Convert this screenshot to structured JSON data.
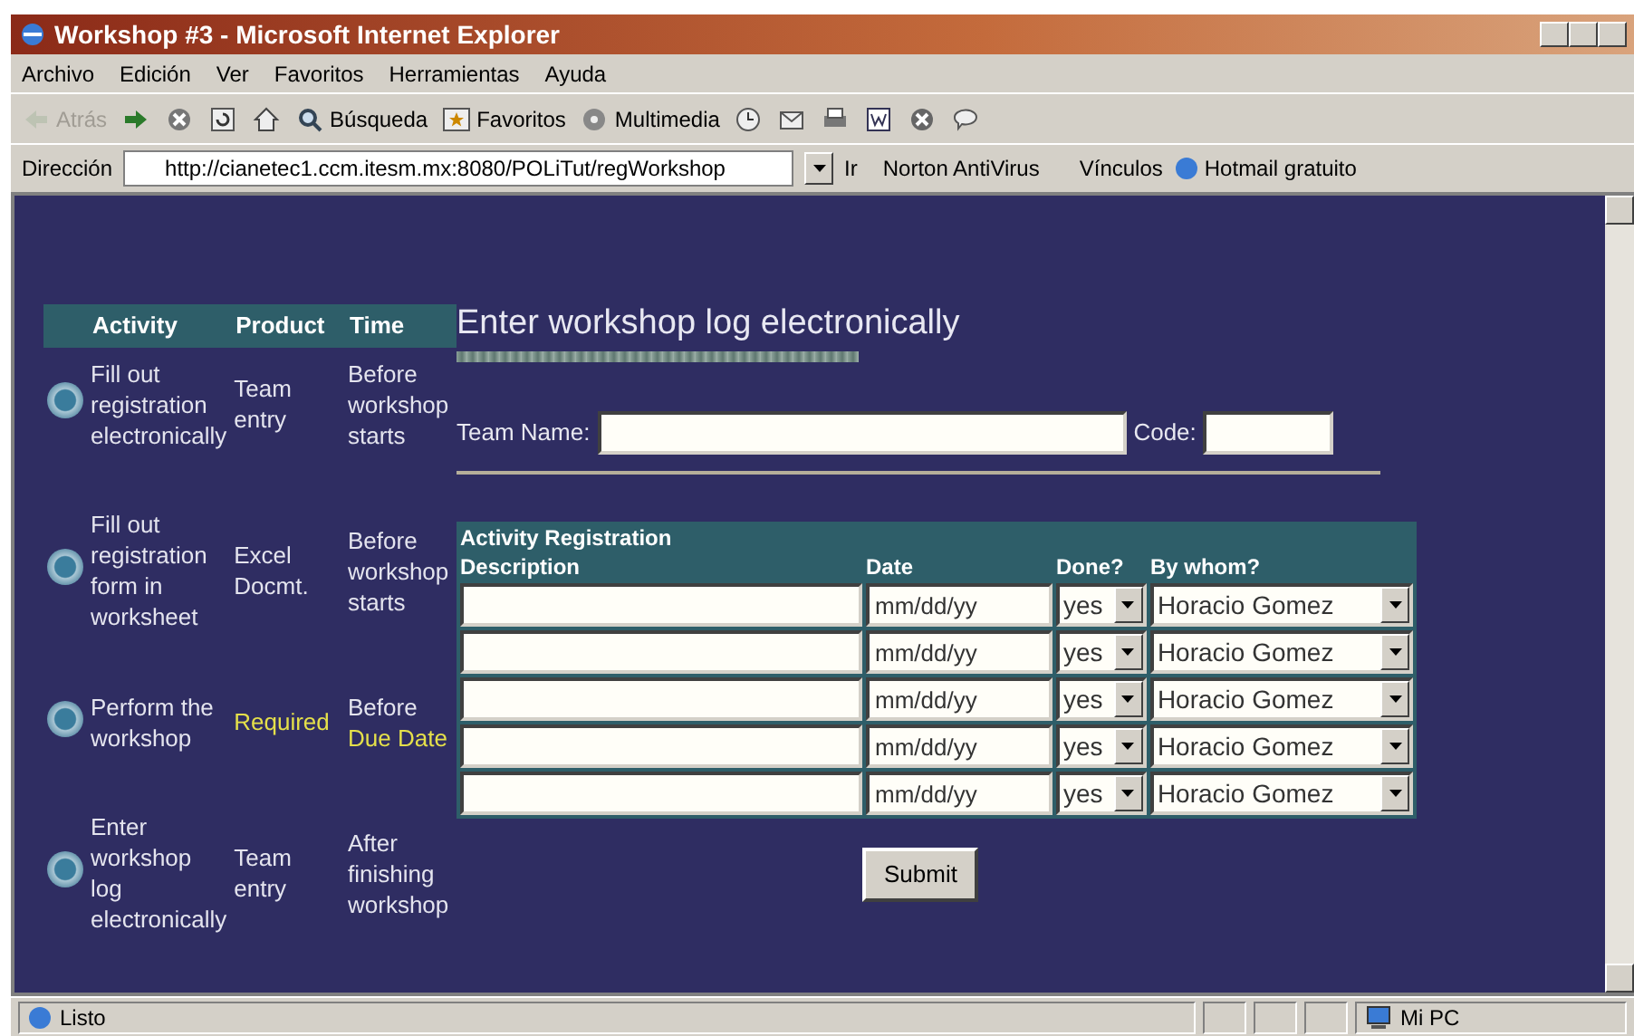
{
  "window": {
    "title": "Workshop #3 - Microsoft Internet Explorer"
  },
  "menu": [
    "Archivo",
    "Edición",
    "Ver",
    "Favoritos",
    "Herramientas",
    "Ayuda"
  ],
  "toolbar": [
    {
      "kind": "back",
      "label": "Atrás",
      "disabled": true
    },
    {
      "kind": "forward",
      "disabled": false
    },
    {
      "kind": "stop",
      "disabled": false
    },
    {
      "kind": "refresh",
      "disabled": false
    },
    {
      "kind": "home",
      "disabled": false
    },
    {
      "kind": "search",
      "label": "Búsqueda",
      "disabled": false
    },
    {
      "kind": "favorites",
      "label": "Favoritos",
      "disabled": false
    },
    {
      "kind": "media",
      "label": "Multimedia",
      "disabled": false
    },
    {
      "kind": "history",
      "disabled": false
    },
    {
      "kind": "mail",
      "disabled": false
    },
    {
      "kind": "print",
      "disabled": false
    },
    {
      "kind": "word",
      "disabled": false
    },
    {
      "kind": "close",
      "disabled": false
    },
    {
      "kind": "chat",
      "disabled": false
    }
  ],
  "address_bar": {
    "label": "Dirección",
    "url": "http://cianetec1.ccm.itesm.mx:8080/POLiTut/regWorkshop",
    "go": "Ir",
    "antivirus": "Norton AntiVirus",
    "links_label": "Vínculos",
    "link": "Hotmail gratuito"
  },
  "activities": {
    "columns": [
      "Activity",
      "Product",
      "Time"
    ],
    "rows": [
      {
        "activity": "Fill out registration electronically",
        "product": "Team entry",
        "time": "Before workshop starts",
        "required": false
      },
      {
        "activity": "Fill out registration form in worksheet",
        "product": "Excel Docmt.",
        "time": "Before workshop starts",
        "required": false
      },
      {
        "activity": "Perform the workshop",
        "product": "Required",
        "time": "Before",
        "deadline": "Due Date",
        "required": true
      },
      {
        "activity": "Enter workshop log electronically",
        "product": "Team entry",
        "time": "After finishing workshop",
        "required": false
      }
    ]
  },
  "form": {
    "title": "Enter workshop log electronically",
    "team_name_label": "Team Name:",
    "code_label": "Code:",
    "table_title": "Activity Registration",
    "columns": [
      "Description",
      "Date",
      "Done?",
      "By whom?"
    ],
    "rows": [
      {
        "date": "mm/dd/yy",
        "done": "yes",
        "by_whom": "Horacio Gomez"
      },
      {
        "date": "mm/dd/yy",
        "done": "yes",
        "by_whom": "Horacio Gomez"
      },
      {
        "date": "mm/dd/yy",
        "done": "yes",
        "by_whom": "Horacio Gomez"
      },
      {
        "date": "mm/dd/yy",
        "done": "yes",
        "by_whom": "Horacio Gomez"
      },
      {
        "date": "mm/dd/yy",
        "done": "yes",
        "by_whom": "Horacio Gomez"
      }
    ],
    "submit": "Submit"
  },
  "status_bar": {
    "text": "Listo",
    "zone": "Mi PC"
  }
}
